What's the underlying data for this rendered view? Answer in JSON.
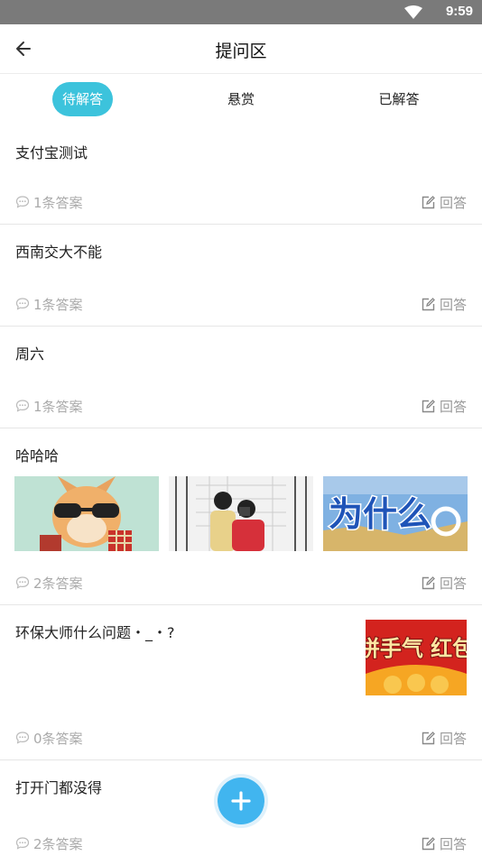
{
  "status_bar": {
    "time": "9:59"
  },
  "header": {
    "title": "提问区"
  },
  "tabs": [
    {
      "label": "待解答",
      "active": true
    },
    {
      "label": "悬赏",
      "active": false
    },
    {
      "label": "已解答",
      "active": false
    }
  ],
  "questions": [
    {
      "title": "支付宝测试",
      "answers": "1条答案",
      "reply": "回答"
    },
    {
      "title": "西南交大不能",
      "answers": "1条答案",
      "reply": "回答"
    },
    {
      "title": "周六",
      "answers": "1条答案",
      "reply": "回答"
    },
    {
      "title": "哈哈哈",
      "answers": "2条答案",
      "reply": "回答"
    },
    {
      "title": "环保大师什么问题・_・?",
      "answers": "0条答案",
      "reply": "回答"
    },
    {
      "title": "打开门都没得",
      "answers": "2条答案",
      "reply": "回答"
    }
  ],
  "images": {
    "thumb_3": "为什么",
    "side_thumb": "拼手气 红包"
  },
  "colors": {
    "accent": "#3cc3dc",
    "fab": "#41b5ef",
    "status_bar": "#7a7a7a"
  }
}
